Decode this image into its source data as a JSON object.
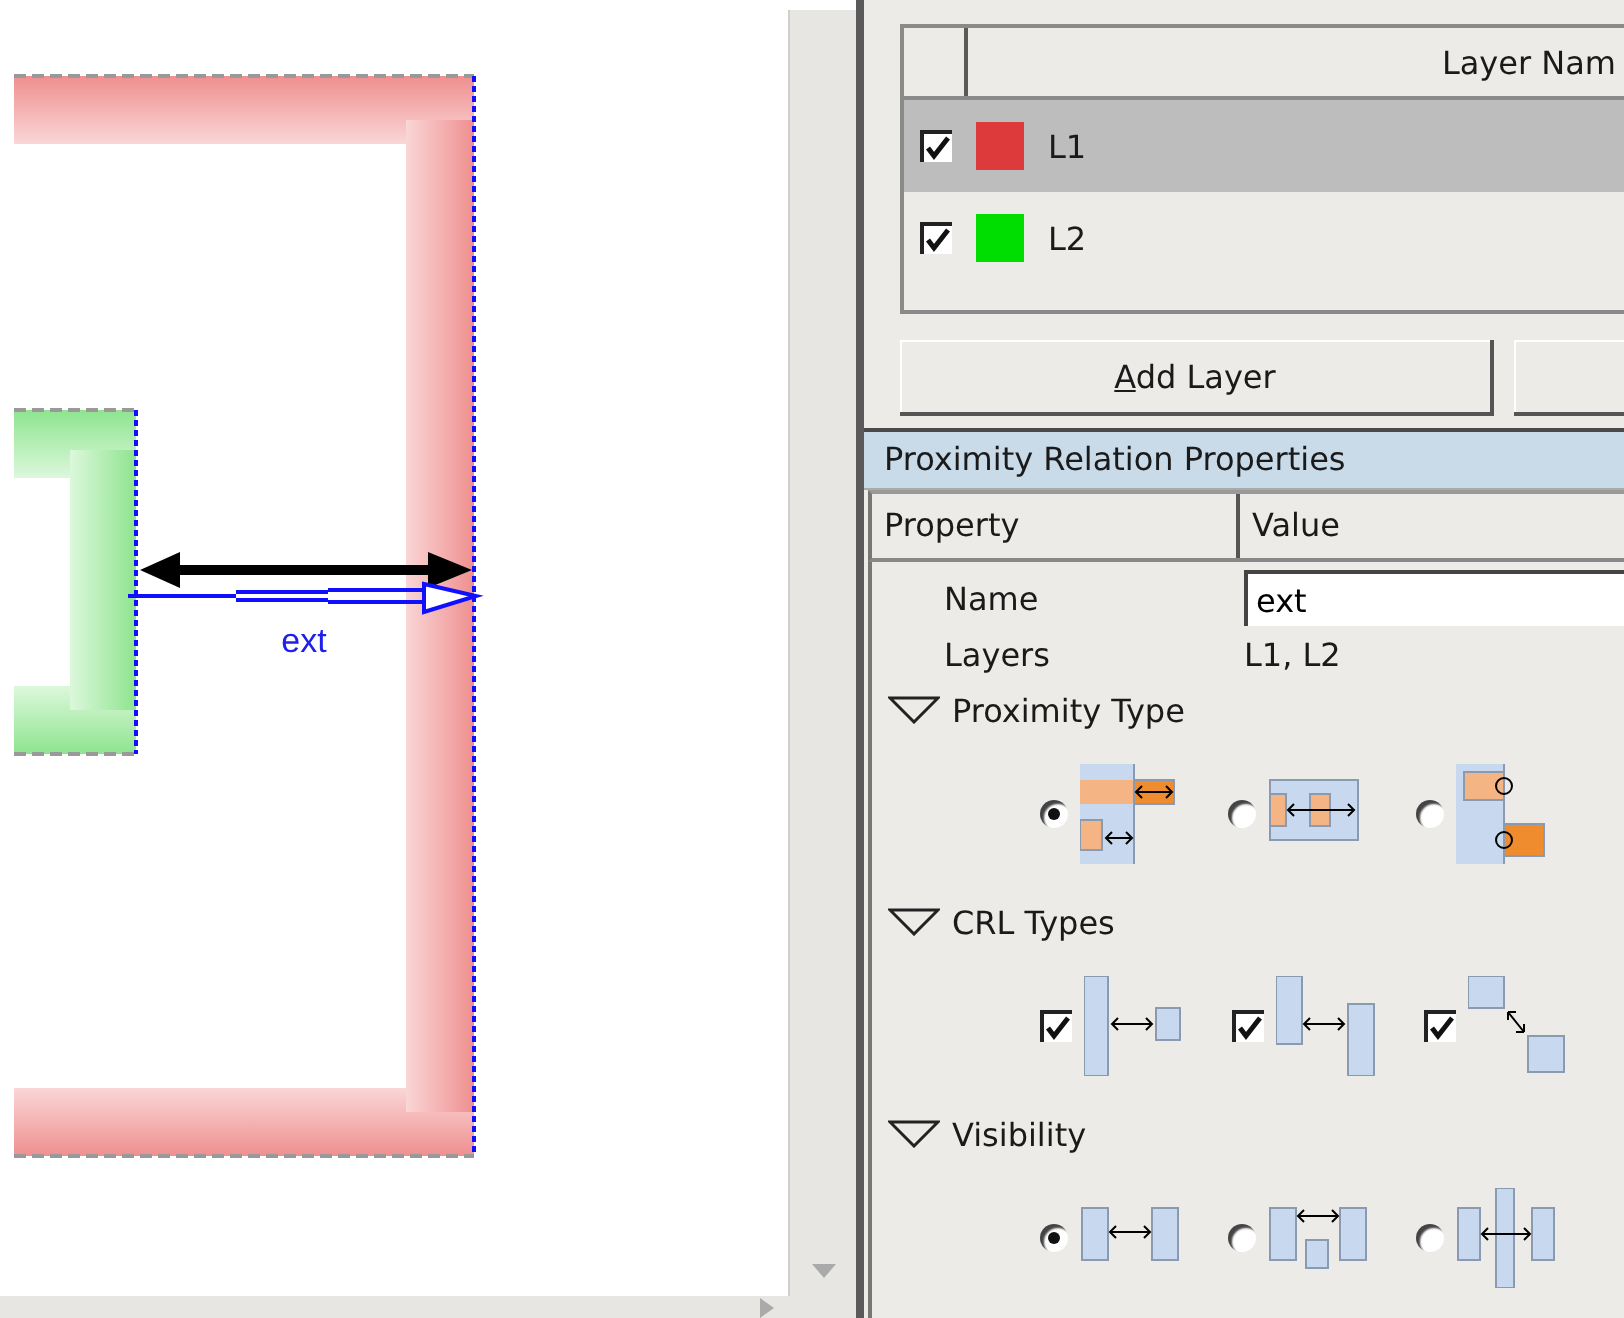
{
  "canvas": {
    "relation_label": "ext"
  },
  "layer_table": {
    "columns": [
      "Layer Nam"
    ],
    "rows": [
      {
        "name": "L1",
        "checked": true,
        "color": "#dd3b3b",
        "selected": true
      },
      {
        "name": "L2",
        "checked": true,
        "color": "#00dd00",
        "selected": false
      }
    ]
  },
  "buttons": [
    {
      "kind": "text",
      "label": "Add Layer",
      "mnemonic": true
    },
    {
      "kind": "blank"
    }
  ],
  "properties": {
    "title": "Proximity Relation Properties",
    "columns": [
      "Property",
      "Value"
    ],
    "name_field": {
      "label": "Name",
      "value": "ext"
    },
    "layers_row": {
      "label": "Layers",
      "value": "L1, L2"
    },
    "groups": [
      {
        "title": "Proximity Type",
        "expanded": true,
        "kind": "radio",
        "options": [
          {
            "selected": true
          },
          {
            "selected": false
          },
          {
            "selected": false
          }
        ]
      },
      {
        "title": "CRL Types",
        "expanded": true,
        "kind": "checkbox",
        "options": [
          {
            "checked": true
          },
          {
            "checked": true
          },
          {
            "checked": true
          }
        ]
      },
      {
        "title": "Visibility",
        "expanded": true,
        "kind": "radio",
        "options": [
          {
            "selected": true
          },
          {
            "selected": false
          },
          {
            "selected": false
          }
        ]
      }
    ]
  }
}
